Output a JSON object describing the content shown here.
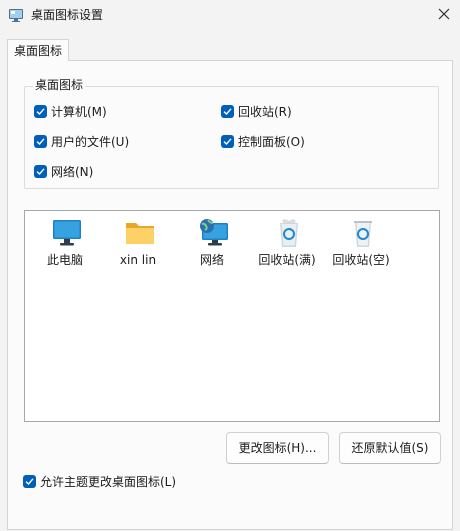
{
  "window": {
    "title": "桌面图标设置"
  },
  "tabs": [
    {
      "label": "桌面图标"
    }
  ],
  "group": {
    "legend": "桌面图标",
    "checkboxes": {
      "computer": {
        "label": "计算机(M)",
        "checked": true
      },
      "recycle": {
        "label": "回收站(R)",
        "checked": true
      },
      "user_files": {
        "label": "用户的文件(U)",
        "checked": true
      },
      "control_panel": {
        "label": "控制面板(O)",
        "checked": true
      },
      "network": {
        "label": "网络(N)",
        "checked": true
      }
    }
  },
  "icons": [
    {
      "label": "此电脑",
      "icon": "monitor-icon"
    },
    {
      "label": "xin lin",
      "icon": "folder-icon"
    },
    {
      "label": "网络",
      "icon": "network-icon"
    },
    {
      "label": "回收站(满)",
      "icon": "recycle-bin-full-icon"
    },
    {
      "label": "回收站(空)",
      "icon": "recycle-bin-empty-icon"
    }
  ],
  "buttons": {
    "change_icon": "更改图标(H)...",
    "restore_default": "还原默认值(S)"
  },
  "allow_themes": {
    "label": "允许主题更改桌面图标(L)",
    "checked": true
  },
  "colors": {
    "accent": "#005fb8",
    "background": "#f3f3f3",
    "panel": "#fbfbfb"
  }
}
